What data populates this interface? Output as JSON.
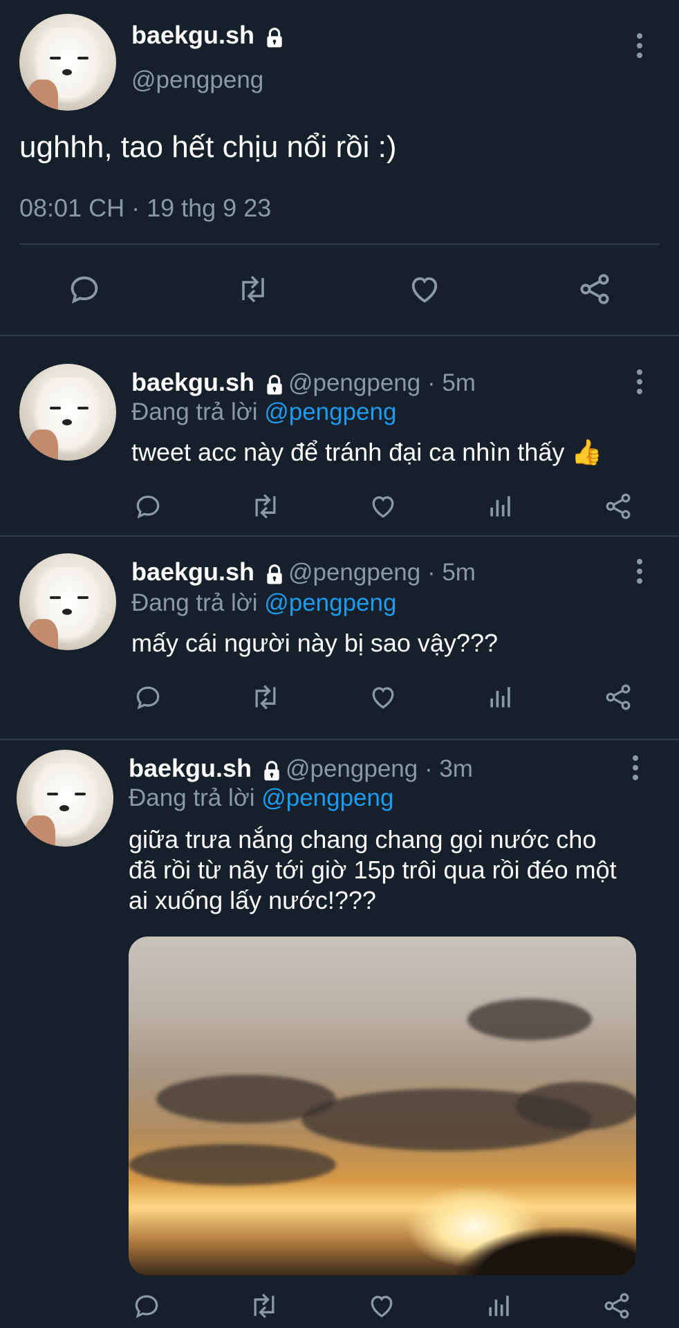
{
  "main_tweet": {
    "display_name": "baekgu.sh",
    "handle": "@pengpeng",
    "text": "ughhh, tao hết chịu nổi rồi :)",
    "timestamp": "08:01 CH · 19 thg 9 23"
  },
  "replies": [
    {
      "display_name": "baekgu.sh",
      "handle_time": "@pengpeng · 5m",
      "replying_prefix": "Đang trả lời",
      "replying_to": "@pengpeng",
      "text": "tweet acc này để tránh đại ca nhìn thấy 👍"
    },
    {
      "display_name": "baekgu.sh",
      "handle_time": "@pengpeng · 5m",
      "replying_prefix": "Đang trả lời",
      "replying_to": "@pengpeng",
      "text": "mấy cái người này bị sao vậy???"
    },
    {
      "display_name": "baekgu.sh",
      "handle_time": "@pengpeng · 3m",
      "replying_prefix": "Đang trả lời",
      "replying_to": "@pengpeng",
      "text_lines": [
        "giữa trưa nắng chang chang gọi nước cho",
        "đã rồi từ nãy tới giờ 15p trôi qua rồi đéo một",
        "ai xuống lấy nước!???"
      ],
      "has_media": true
    }
  ],
  "icons": {
    "reply": "reply-icon",
    "retweet": "retweet-icon",
    "like": "heart-icon",
    "views": "views-icon",
    "share": "share-icon",
    "more": "more-icon",
    "protected": "lock-icon"
  },
  "colors": {
    "background": "#15202b",
    "text": "#ffffff",
    "muted": "#8b98a5",
    "link": "#1d9bf0",
    "divider": "#2f3b47"
  }
}
